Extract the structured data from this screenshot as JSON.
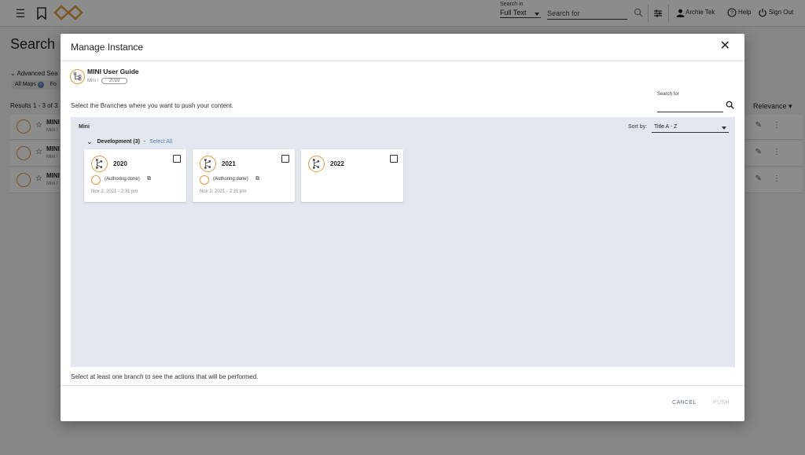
{
  "topbar": {
    "search_in_label": "Search in",
    "search_in_value": "Full Text",
    "search_placeholder": "Search for",
    "user_name": "Archie Tek",
    "help_label": "Help",
    "signout_label": "Sign Out"
  },
  "background": {
    "page_title": "Search",
    "advanced_label": "Advanced Sea",
    "chip_label": "All Maps",
    "chip2_label": "Fo",
    "results_label": "Results 1 - 3 of 3",
    "relevance_label": "Relevance",
    "rows": [
      {
        "name": "MINI",
        "sub": "Mini /"
      },
      {
        "name": "MINI",
        "sub": "Mini /"
      },
      {
        "name": "MINI",
        "sub": "Mini /"
      }
    ]
  },
  "modal": {
    "title": "Manage Instance",
    "map_name": "MINI User Guide",
    "map_path": "Mini /",
    "map_version": "2019",
    "instruction": "Select the Branches where you want to push your content.",
    "search_label": "Search for",
    "panel_title": "Mini",
    "sort_label": "Sort by:",
    "sort_value": "Title A - Z",
    "group_name": "Development (3)",
    "group_sep": "-",
    "select_all": "Select All",
    "branches": [
      {
        "year": "2020",
        "status": "(Authoring:done)",
        "date": "Nov 2, 2021 - 2:31 pm"
      },
      {
        "year": "2021",
        "status": "(Authoring:done)",
        "date": "Nov 2, 2021 - 2:31 pm"
      },
      {
        "year": "2022",
        "status": "",
        "date": ""
      }
    ],
    "footer_message": "Select at least one branch to see the actions that will be performed.",
    "cancel_label": "CANCEL",
    "push_label": "PUSH"
  },
  "colors": {
    "accent_orange": "#e59a3a",
    "link_blue": "#5b7fb2",
    "panel_bg": "#e3e7ef"
  }
}
